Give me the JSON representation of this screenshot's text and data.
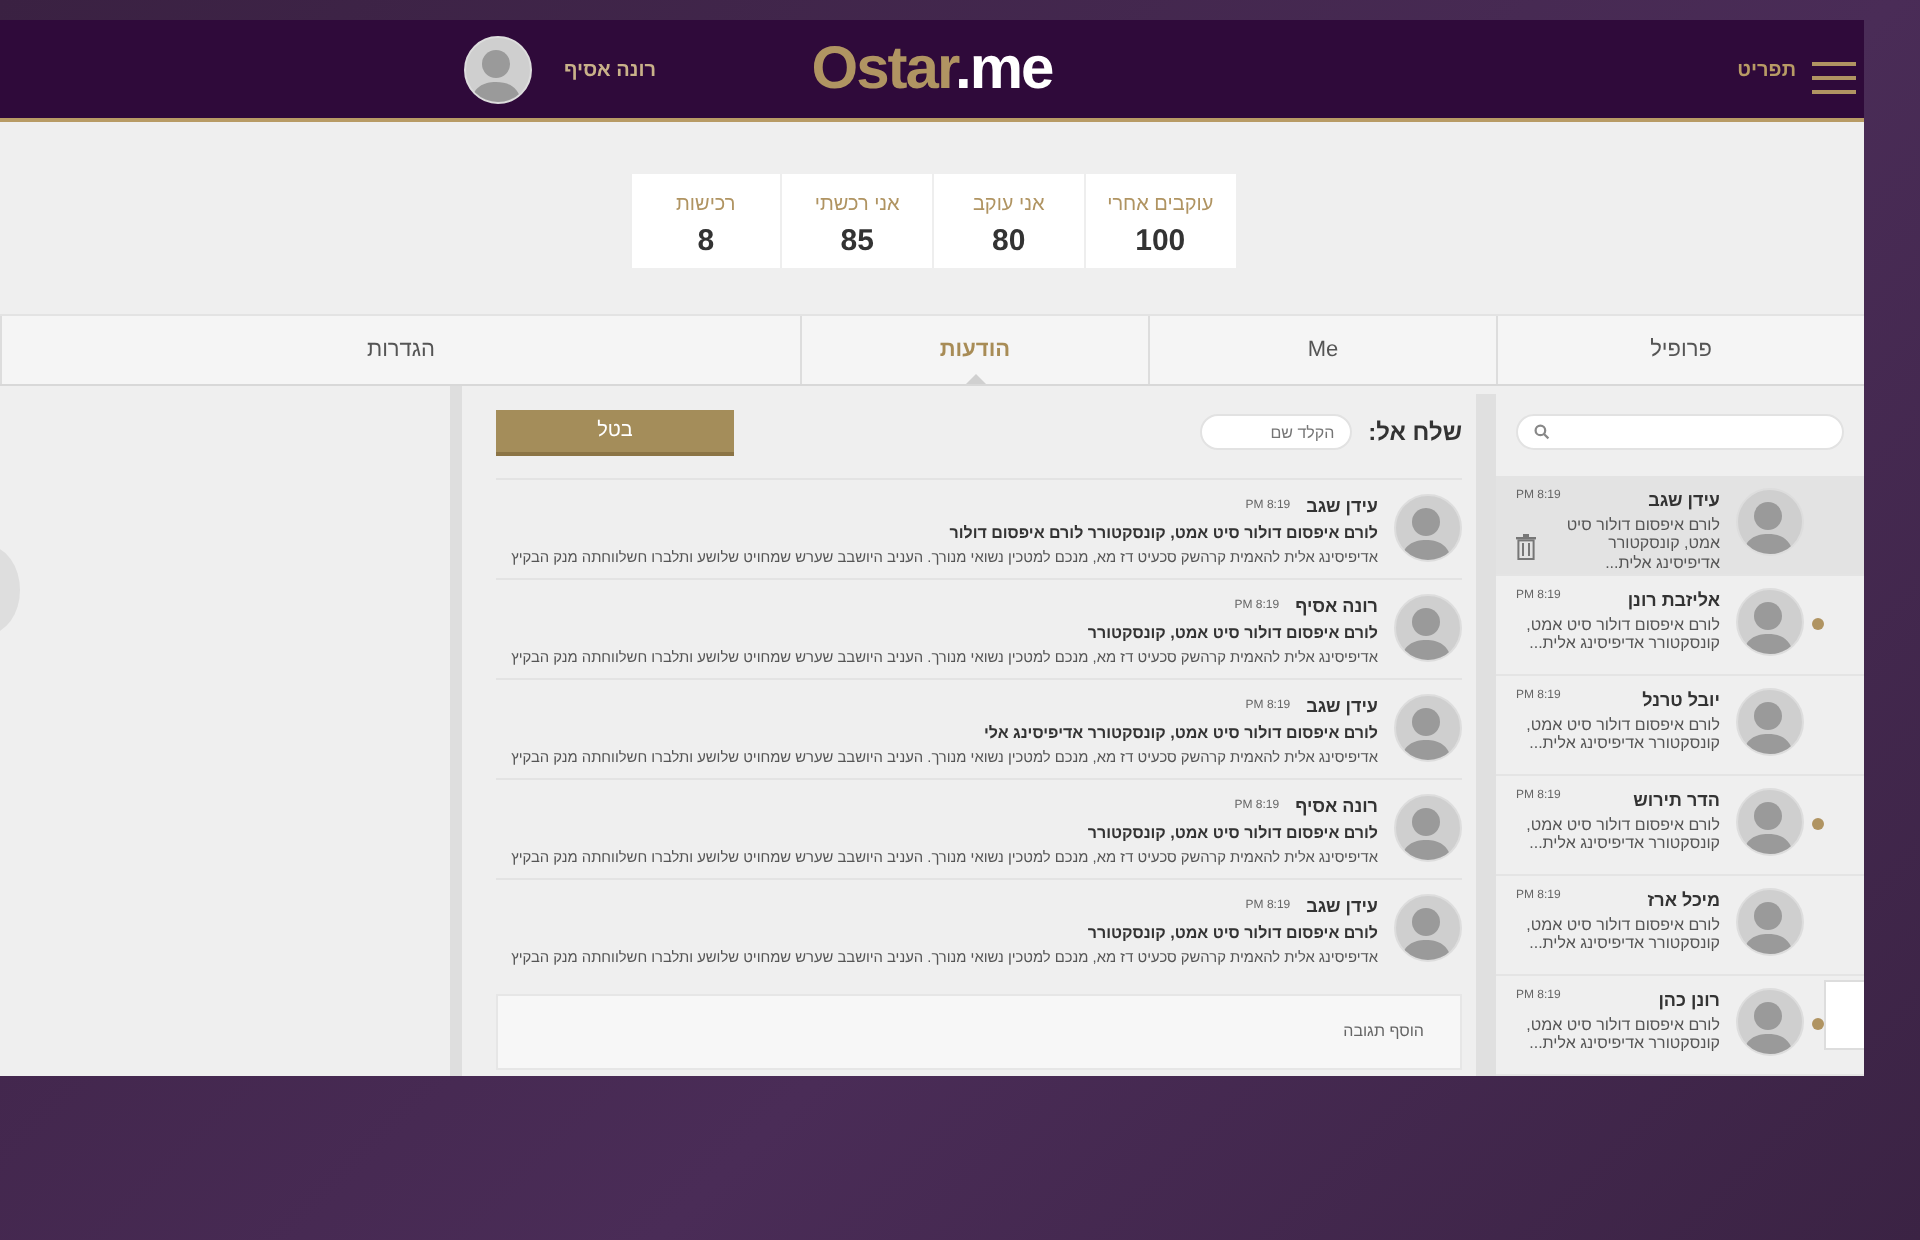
{
  "header": {
    "menu_label": "תפריט",
    "logo": {
      "initial": "O",
      "name": "star",
      "suffix": ".me"
    },
    "user_name": "רונה אסיף"
  },
  "stats": [
    {
      "label": "עוקבים אחרי",
      "value": "100"
    },
    {
      "label": "אני עוקב",
      "value": "80"
    },
    {
      "label": "אני רכשתי",
      "value": "85"
    },
    {
      "label": "רכישות",
      "value": "8"
    }
  ],
  "tabs": [
    {
      "label": "פרופיל",
      "selected": false
    },
    {
      "label": "Me",
      "selected": false
    },
    {
      "label": "הודעות",
      "selected": true
    },
    {
      "label": "הגדרות",
      "selected": false
    }
  ],
  "conversations": [
    {
      "name": "עידן שגב",
      "time": "8:19 PM",
      "preview": "לורם איפסום דולור סיט אמט, קונסקטורר אדיפיסינג אלית...",
      "selected": true,
      "unread": false
    },
    {
      "name": "אליזבת רונן",
      "time": "8:19 PM",
      "preview": "לורם איפסום דולור סיט אמט, קונסקטורר אדיפיסינג אלית...",
      "selected": false,
      "unread": true
    },
    {
      "name": "יובל טרנל",
      "time": "8:19 PM",
      "preview": "לורם איפסום דולור סיט אמט, קונסקטורר אדיפיסינג אלית...",
      "selected": false,
      "unread": false
    },
    {
      "name": "הדר תירוש",
      "time": "8:19 PM",
      "preview": "לורם איפסום דולור סיט אמט, קונסקטורר אדיפיסינג אלית...",
      "selected": false,
      "unread": true
    },
    {
      "name": "מיכל ארז",
      "time": "8:19 PM",
      "preview": "לורם איפסום דולור סיט אמט, קונסקטורר אדיפיסינג אלית...",
      "selected": false,
      "unread": false
    },
    {
      "name": "רונן כהן",
      "time": "8:19 PM",
      "preview": "לורם איפסום דולור סיט אמט, קונסקטורר אדיפיסינג אלית...",
      "selected": false,
      "unread": true
    }
  ],
  "compose": {
    "to_label": "שלח אל:",
    "to_placeholder": "הקלד שם",
    "cancel_button": "בטל"
  },
  "messages": [
    {
      "name": "עידן שגב",
      "time": "8:19 PM",
      "subject": "לורם איפסום דולור סיט אמט, קונסקטורר לורם איפסום דולור",
      "body": "אדיפיסינג אלית להאמית קרהשק סכעיט דז מא, מנכם למטכין נשואי מנורך. העניב היושבב שערש שמחויט  שלושע ותלברו חשלווחתה מנק הבקיץ"
    },
    {
      "name": "רונה אסיף",
      "time": "8:19 PM",
      "subject": "לורם איפסום דולור סיט אמט, קונסקטורר",
      "body": "אדיפיסינג אלית להאמית קרהשק סכעיט דז מא, מנכם למטכין נשואי מנורך. העניב היושבב שערש שמחויט  שלושע ותלברו חשלווחתה מנק הבקיץ"
    },
    {
      "name": "עידן שגב",
      "time": "8:19 PM",
      "subject": "לורם איפסום דולור סיט אמט, קונסקטורר אדיפיסינג אלי",
      "body": "אדיפיסינג אלית להאמית קרהשק סכעיט דז מא, מנכם למטכין נשואי מנורך. העניב היושבב שערש שמחויט  שלושע ותלברו חשלווחתה מנק הבקיץ"
    },
    {
      "name": "רונה אסיף",
      "time": "8:19 PM",
      "subject": "לורם איפסום דולור סיט אמט, קונסקטורר",
      "body": "אדיפיסינג אלית להאמית קרהשק סכעיט דז מא, מנכם למטכין נשואי מנורך. העניב היושבב שערש שמחויט  שלושע ותלברו חשלווחתה מנק הבקיץ"
    },
    {
      "name": "עידן שגב",
      "time": "8:19 PM",
      "subject": "לורם איפסום דולור סיט אמט, קונסקטורר",
      "body": "אדיפיסינג אלית להאמית קרהשק סכעיט דז מא, מנכם למטכין נשואי מנורך. העניב היושבב שערש שמחויט  שלושע ותלברו חשלווחתה מנק הבקיץ"
    }
  ],
  "reply": {
    "placeholder": "הוסף תגובה"
  }
}
